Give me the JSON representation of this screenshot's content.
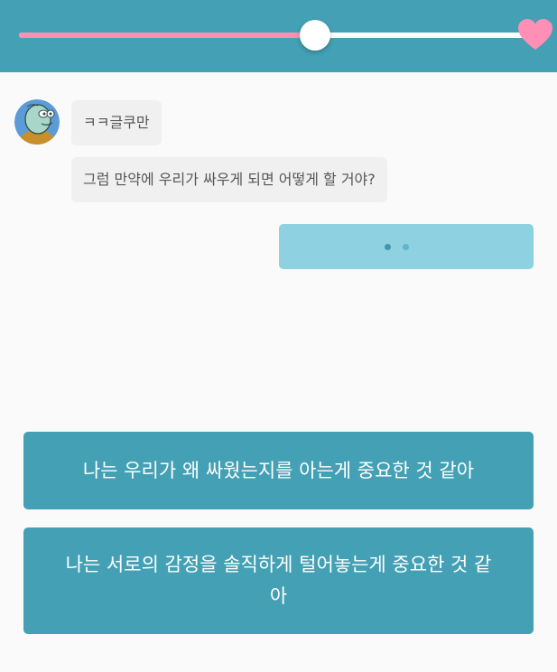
{
  "progress": {
    "value": 0.574,
    "fill_color": "#ff8fb4",
    "track_color": "#ffffff",
    "end_icon": "heart-icon",
    "end_icon_color": "#ff8fb4"
  },
  "header": {
    "background_color": "#44a0b4"
  },
  "chat": {
    "avatar_icon": "character-avatar",
    "messages": [
      {
        "text": "ㅋㅋ글쿠만"
      },
      {
        "text": "그럼 만약에 우리가 싸우게 되면 어떻게 할 거야?"
      }
    ],
    "typing_indicator": {
      "icon": "typing-dots-icon",
      "color": "#8ed1e0"
    }
  },
  "choices": [
    {
      "label": "나는 우리가 왜 싸웠는지를 아는게 중요한 것 같아"
    },
    {
      "label": "나는 서로의 감정을 솔직하게 털어놓는게 중요한 것 같아"
    }
  ],
  "choice_color": "#44a0b4"
}
